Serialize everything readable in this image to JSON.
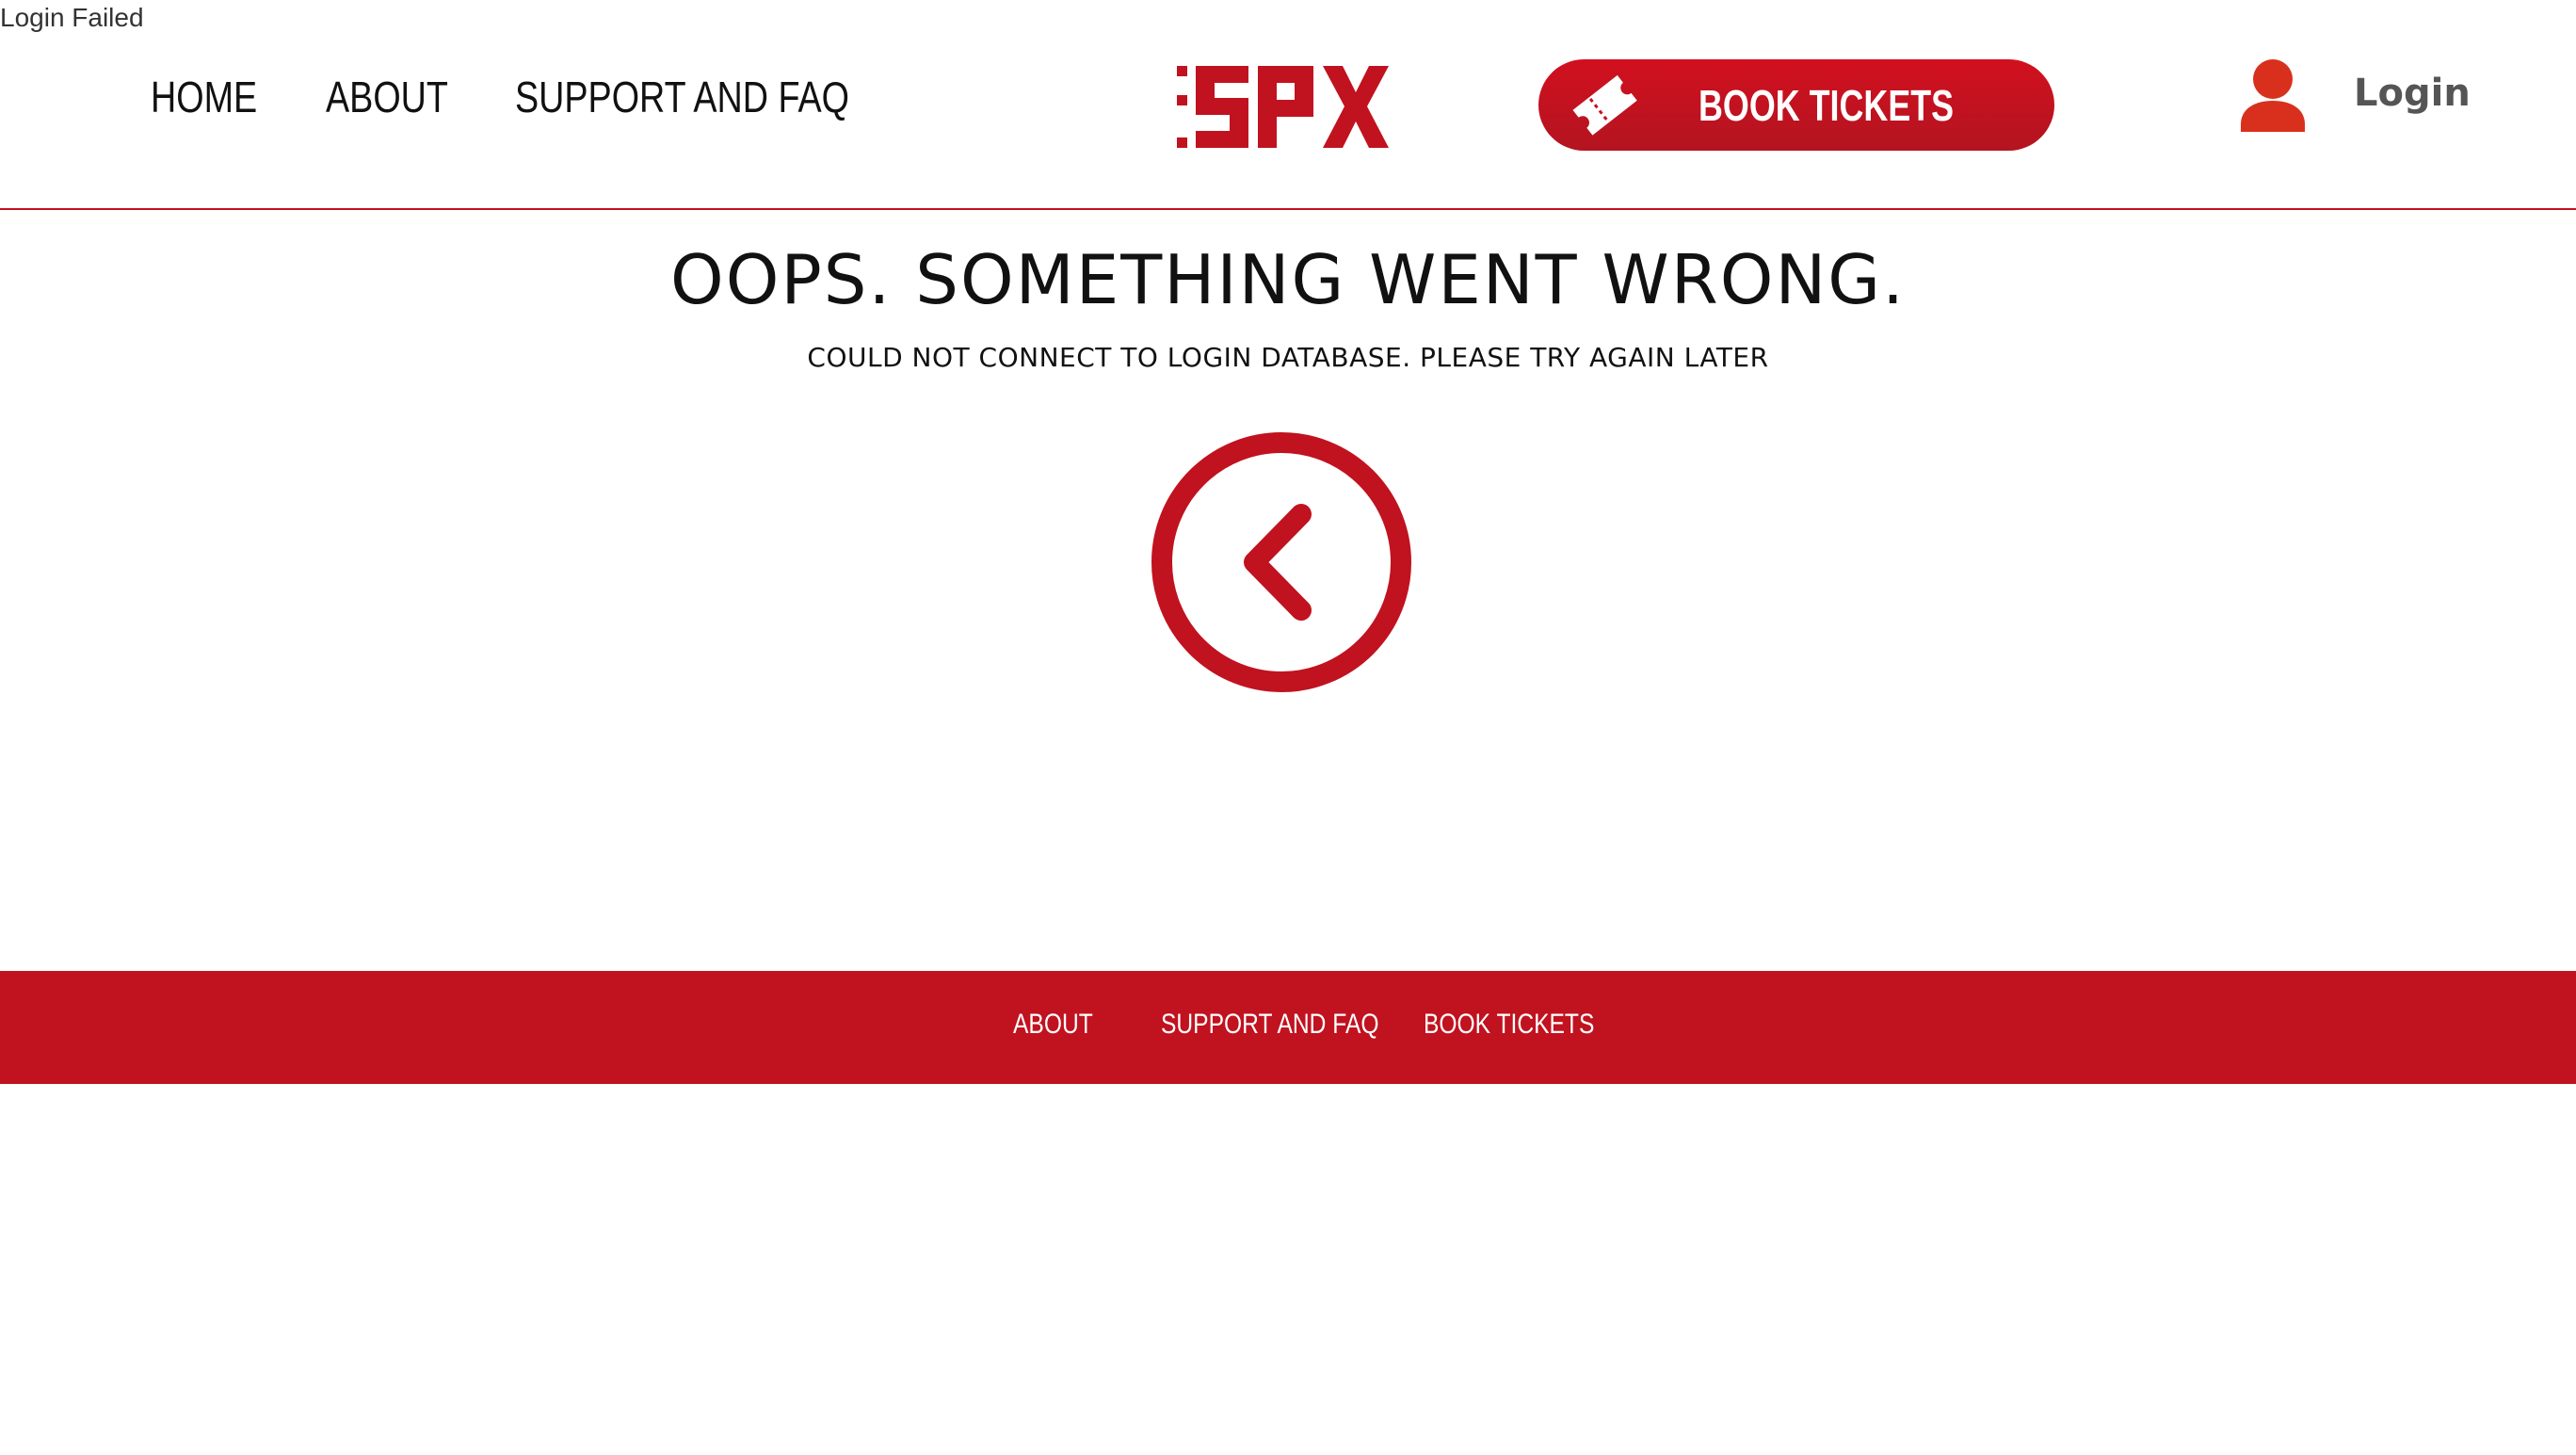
{
  "status": {
    "text": "Login Failed"
  },
  "header": {
    "nav": [
      {
        "label": "HOME"
      },
      {
        "label": "ABOUT"
      },
      {
        "label": "SUPPORT AND FAQ"
      }
    ],
    "logo_text": ":SPX",
    "book_button": {
      "label": "BOOK TICKETS",
      "icon": "ticket-icon"
    },
    "login": {
      "label": "Login",
      "icon": "user-icon"
    }
  },
  "main": {
    "title": "OOPS. SOMETHING WENT WRONG.",
    "message": "COULD NOT CONNECT TO LOGIN DATABASE. PLEASE TRY AGAIN LATER",
    "back_icon": "chevron-left-circle-icon"
  },
  "footer": {
    "links": [
      {
        "label": "ABOUT"
      },
      {
        "label": "SUPPORT AND FAQ"
      },
      {
        "label": "BOOK TICKETS"
      }
    ]
  },
  "colors": {
    "brand_red": "#c1121f",
    "text_dark": "#111111",
    "login_gray": "#555555",
    "user_icon": "#d9301e"
  }
}
